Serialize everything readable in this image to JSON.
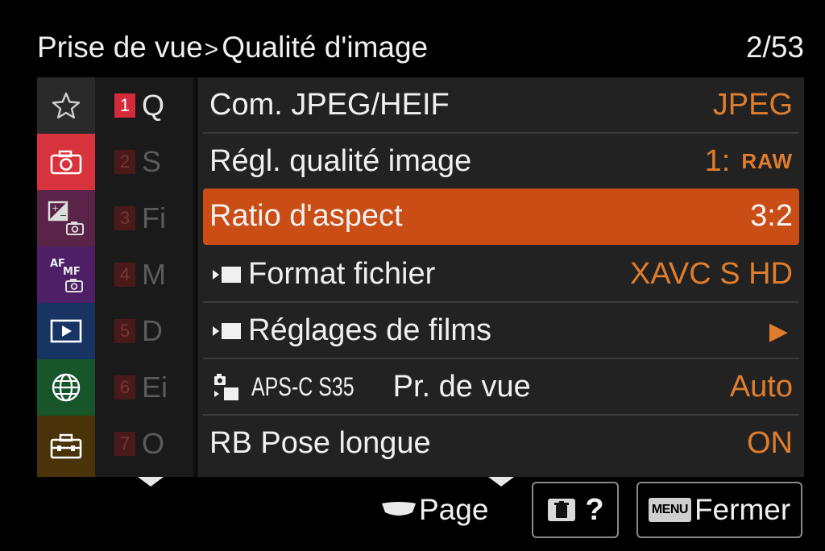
{
  "header": {
    "breadcrumb_section": "Prise de vue",
    "breadcrumb_separator": ">",
    "breadcrumb_page": "Qualité d'image",
    "page_indicator": "2/53"
  },
  "categories": [
    {
      "icon": "star-icon",
      "color": "#2a2a2a"
    },
    {
      "icon": "camera-icon",
      "color": "#d8323c"
    },
    {
      "icon": "exposure-camera-icon",
      "color": "#5a2448"
    },
    {
      "icon": "af-mf-icon",
      "color": "#4e1f66"
    },
    {
      "icon": "playback-icon",
      "color": "#173463"
    },
    {
      "icon": "globe-icon",
      "color": "#17552a"
    },
    {
      "icon": "toolbox-icon",
      "color": "#4a3209"
    }
  ],
  "subcategories": [
    {
      "num": "1",
      "label": "Q",
      "active": true
    },
    {
      "num": "2",
      "label": "S",
      "active": false
    },
    {
      "num": "3",
      "label": "Fi",
      "active": false
    },
    {
      "num": "4",
      "label": "M",
      "active": false
    },
    {
      "num": "5",
      "label": "D",
      "active": false
    },
    {
      "num": "6",
      "label": "Ei",
      "active": false
    },
    {
      "num": "7",
      "label": "O",
      "active": false
    }
  ],
  "items": [
    {
      "label": "Com. JPEG/HEIF",
      "value": "JPEG"
    },
    {
      "label": "Régl. qualité image",
      "value": "1:",
      "value_extra": "RAW"
    },
    {
      "label": "Ratio d'aspect",
      "value": "3:2",
      "selected": true
    },
    {
      "label": "Format fichier",
      "value": "XAVC S HD",
      "prefix_icon": "movie-icon"
    },
    {
      "label": "Réglages de films",
      "value": "▶",
      "prefix_icon": "movie-icon"
    },
    {
      "label": "Pr. de vue",
      "value": "Auto",
      "prefix_icon": "still-movie-icon",
      "prefix_text": "APS-C S35"
    },
    {
      "label": "RB Pose longue",
      "value": "ON"
    }
  ],
  "footer": {
    "page_label": "Page",
    "help_label": "?",
    "menu_key": "MENU",
    "close_label": "Fermer"
  },
  "colors": {
    "accent_orange": "#e07d2c",
    "selected_row": "#c94d14",
    "active_tab": "#d8323c"
  }
}
